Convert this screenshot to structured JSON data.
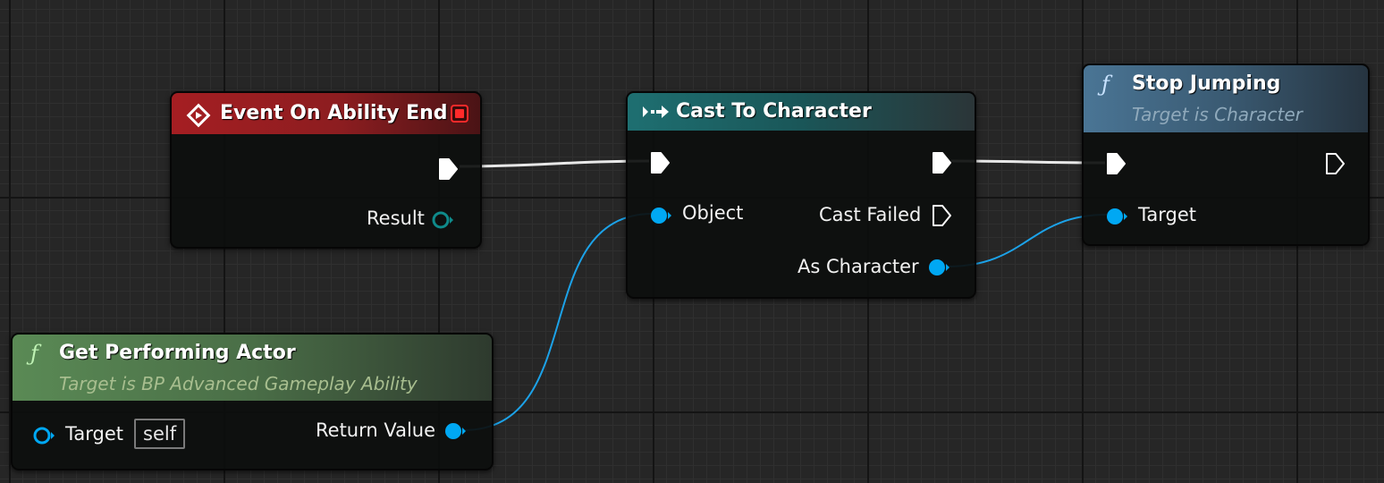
{
  "colors": {
    "event_header": "#a51e22",
    "cast_header": "#1e6f71",
    "stop_jumping_header": "#4a7595",
    "get_performing_header": "#5a8a55",
    "object_pin": "#00a8f3",
    "exec_pin": "#ffffff",
    "wire_object": "#1ca2e8"
  },
  "nodes": {
    "event_on_ability_end": {
      "title": "Event On Ability End",
      "icon": "event-diamond-icon",
      "outputs": {
        "result_label": "Result"
      }
    },
    "cast_to_character": {
      "title": "Cast To Character",
      "icon": "cast-arrow-icon",
      "inputs": {
        "object_label": "Object"
      },
      "outputs": {
        "cast_failed_label": "Cast Failed",
        "as_character_label": "As Character"
      }
    },
    "stop_jumping": {
      "title": "Stop Jumping",
      "subtitle": "Target is Character",
      "icon": "function-icon",
      "inputs": {
        "target_label": "Target"
      }
    },
    "get_performing_actor": {
      "title": "Get Performing Actor",
      "subtitle": "Target is BP Advanced Gameplay Ability",
      "icon": "function-icon",
      "inputs": {
        "target_label": "Target",
        "target_value": "self"
      },
      "outputs": {
        "return_value_label": "Return Value"
      }
    }
  }
}
